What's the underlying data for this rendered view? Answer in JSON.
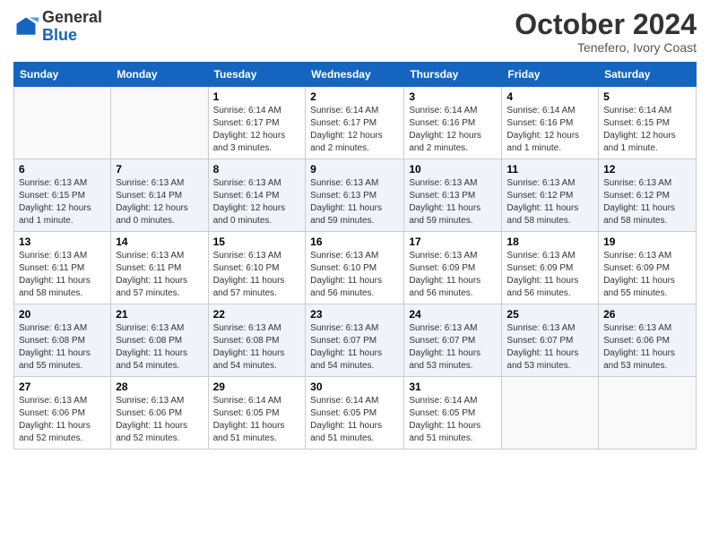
{
  "logo": {
    "line1": "General",
    "line2": "Blue"
  },
  "title": "October 2024",
  "subtitle": "Tenefero, Ivory Coast",
  "days_header": [
    "Sunday",
    "Monday",
    "Tuesday",
    "Wednesday",
    "Thursday",
    "Friday",
    "Saturday"
  ],
  "weeks": [
    [
      {
        "num": "",
        "info": ""
      },
      {
        "num": "",
        "info": ""
      },
      {
        "num": "1",
        "info": "Sunrise: 6:14 AM\nSunset: 6:17 PM\nDaylight: 12 hours and 3 minutes."
      },
      {
        "num": "2",
        "info": "Sunrise: 6:14 AM\nSunset: 6:17 PM\nDaylight: 12 hours and 2 minutes."
      },
      {
        "num": "3",
        "info": "Sunrise: 6:14 AM\nSunset: 6:16 PM\nDaylight: 12 hours and 2 minutes."
      },
      {
        "num": "4",
        "info": "Sunrise: 6:14 AM\nSunset: 6:16 PM\nDaylight: 12 hours and 1 minute."
      },
      {
        "num": "5",
        "info": "Sunrise: 6:14 AM\nSunset: 6:15 PM\nDaylight: 12 hours and 1 minute."
      }
    ],
    [
      {
        "num": "6",
        "info": "Sunrise: 6:13 AM\nSunset: 6:15 PM\nDaylight: 12 hours and 1 minute."
      },
      {
        "num": "7",
        "info": "Sunrise: 6:13 AM\nSunset: 6:14 PM\nDaylight: 12 hours and 0 minutes."
      },
      {
        "num": "8",
        "info": "Sunrise: 6:13 AM\nSunset: 6:14 PM\nDaylight: 12 hours and 0 minutes."
      },
      {
        "num": "9",
        "info": "Sunrise: 6:13 AM\nSunset: 6:13 PM\nDaylight: 11 hours and 59 minutes."
      },
      {
        "num": "10",
        "info": "Sunrise: 6:13 AM\nSunset: 6:13 PM\nDaylight: 11 hours and 59 minutes."
      },
      {
        "num": "11",
        "info": "Sunrise: 6:13 AM\nSunset: 6:12 PM\nDaylight: 11 hours and 58 minutes."
      },
      {
        "num": "12",
        "info": "Sunrise: 6:13 AM\nSunset: 6:12 PM\nDaylight: 11 hours and 58 minutes."
      }
    ],
    [
      {
        "num": "13",
        "info": "Sunrise: 6:13 AM\nSunset: 6:11 PM\nDaylight: 11 hours and 58 minutes."
      },
      {
        "num": "14",
        "info": "Sunrise: 6:13 AM\nSunset: 6:11 PM\nDaylight: 11 hours and 57 minutes."
      },
      {
        "num": "15",
        "info": "Sunrise: 6:13 AM\nSunset: 6:10 PM\nDaylight: 11 hours and 57 minutes."
      },
      {
        "num": "16",
        "info": "Sunrise: 6:13 AM\nSunset: 6:10 PM\nDaylight: 11 hours and 56 minutes."
      },
      {
        "num": "17",
        "info": "Sunrise: 6:13 AM\nSunset: 6:09 PM\nDaylight: 11 hours and 56 minutes."
      },
      {
        "num": "18",
        "info": "Sunrise: 6:13 AM\nSunset: 6:09 PM\nDaylight: 11 hours and 56 minutes."
      },
      {
        "num": "19",
        "info": "Sunrise: 6:13 AM\nSunset: 6:09 PM\nDaylight: 11 hours and 55 minutes."
      }
    ],
    [
      {
        "num": "20",
        "info": "Sunrise: 6:13 AM\nSunset: 6:08 PM\nDaylight: 11 hours and 55 minutes."
      },
      {
        "num": "21",
        "info": "Sunrise: 6:13 AM\nSunset: 6:08 PM\nDaylight: 11 hours and 54 minutes."
      },
      {
        "num": "22",
        "info": "Sunrise: 6:13 AM\nSunset: 6:08 PM\nDaylight: 11 hours and 54 minutes."
      },
      {
        "num": "23",
        "info": "Sunrise: 6:13 AM\nSunset: 6:07 PM\nDaylight: 11 hours and 54 minutes."
      },
      {
        "num": "24",
        "info": "Sunrise: 6:13 AM\nSunset: 6:07 PM\nDaylight: 11 hours and 53 minutes."
      },
      {
        "num": "25",
        "info": "Sunrise: 6:13 AM\nSunset: 6:07 PM\nDaylight: 11 hours and 53 minutes."
      },
      {
        "num": "26",
        "info": "Sunrise: 6:13 AM\nSunset: 6:06 PM\nDaylight: 11 hours and 53 minutes."
      }
    ],
    [
      {
        "num": "27",
        "info": "Sunrise: 6:13 AM\nSunset: 6:06 PM\nDaylight: 11 hours and 52 minutes."
      },
      {
        "num": "28",
        "info": "Sunrise: 6:13 AM\nSunset: 6:06 PM\nDaylight: 11 hours and 52 minutes."
      },
      {
        "num": "29",
        "info": "Sunrise: 6:14 AM\nSunset: 6:05 PM\nDaylight: 11 hours and 51 minutes."
      },
      {
        "num": "30",
        "info": "Sunrise: 6:14 AM\nSunset: 6:05 PM\nDaylight: 11 hours and 51 minutes."
      },
      {
        "num": "31",
        "info": "Sunrise: 6:14 AM\nSunset: 6:05 PM\nDaylight: 11 hours and 51 minutes."
      },
      {
        "num": "",
        "info": ""
      },
      {
        "num": "",
        "info": ""
      }
    ]
  ]
}
